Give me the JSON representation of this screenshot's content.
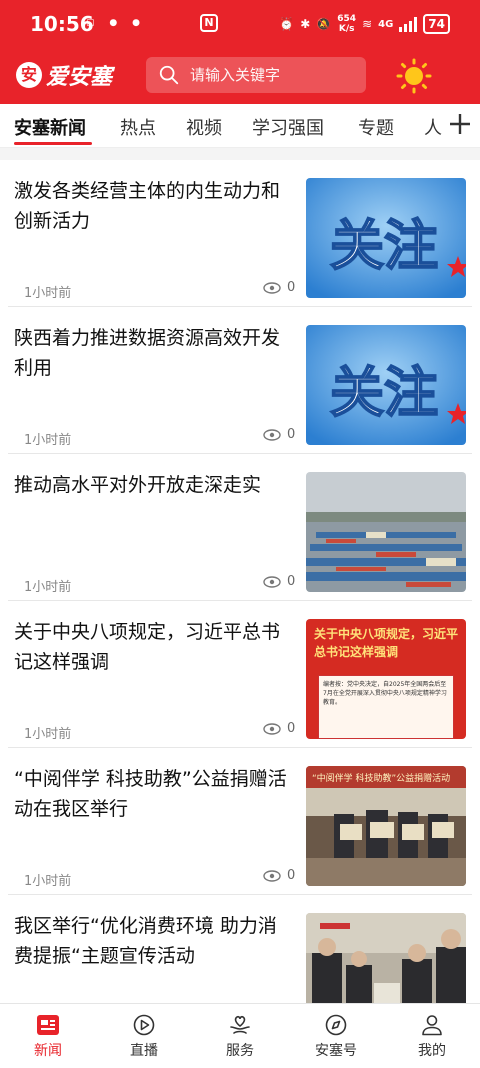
{
  "status_bar": {
    "time": "10:56",
    "speed_top": "654",
    "speed_bottom": "K/s",
    "network": "4G",
    "battery": "74"
  },
  "header": {
    "app_name": "爱安塞",
    "logo_char": "安",
    "search_placeholder": "请输入关键字"
  },
  "tabs": [
    {
      "label": "安塞新闻"
    },
    {
      "label": "热点"
    },
    {
      "label": "视频"
    },
    {
      "label": "学习强国"
    },
    {
      "label": "专题"
    },
    {
      "label": "人"
    }
  ],
  "feed": [
    {
      "title": "激发各类经营主体的内生动力和创新活力",
      "time": "1小时前",
      "views": "0",
      "thumb": "关注"
    },
    {
      "title": "陕西着力推进数据资源高效开发利用",
      "time": "1小时前",
      "views": "0",
      "thumb": "关注"
    },
    {
      "title": "推动高水平对外开放走深走实",
      "time": "1小时前",
      "views": "0",
      "thumb": ""
    },
    {
      "title": "关于中央八项规定，习近平总书记这样强调",
      "time": "1小时前",
      "views": "0",
      "thumb": "关于中央八项规定，习近平总书记这样强调",
      "thumb_text": "编者按：党中央决定，自2025年全国两会后至7月在全党开展深入贯彻中央八项规定精神学习教育。"
    },
    {
      "title": "“中阅伴学 科技助教”公益捐赠活动在我区举行",
      "time": "1小时前",
      "views": "0",
      "thumb": "“中阅伴学 科技助教”公益捐赠活动"
    },
    {
      "title": "我区举行“优化消费环境 助力消费提振“主题宣传活动",
      "time": "",
      "views": "",
      "thumb": ""
    }
  ],
  "bottom_nav": [
    {
      "label": "新闻",
      "icon": "news-icon"
    },
    {
      "label": "直播",
      "icon": "live-icon"
    },
    {
      "label": "服务",
      "icon": "service-icon"
    },
    {
      "label": "安塞号",
      "icon": "compass-icon"
    },
    {
      "label": "我的",
      "icon": "profile-icon"
    }
  ],
  "colors": {
    "brand_red": "#e8232a"
  }
}
